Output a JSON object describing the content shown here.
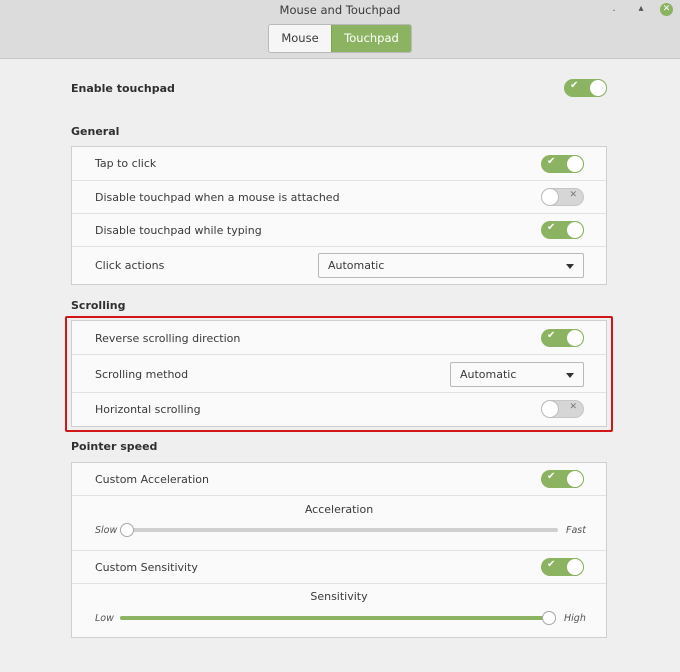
{
  "window": {
    "title": "Mouse and Touchpad"
  },
  "tabs": [
    {
      "label": "Mouse",
      "active": false
    },
    {
      "label": "Touchpad",
      "active": true
    }
  ],
  "enable_touchpad": {
    "label": "Enable touchpad",
    "on": true
  },
  "general": {
    "title": "General",
    "tap_to_click": {
      "label": "Tap to click",
      "on": true
    },
    "disable_when_mouse": {
      "label": "Disable touchpad when a mouse is attached",
      "on": false
    },
    "disable_while_typing": {
      "label": "Disable touchpad while typing",
      "on": true
    },
    "click_actions": {
      "label": "Click actions",
      "value": "Automatic"
    }
  },
  "scrolling": {
    "title": "Scrolling",
    "reverse": {
      "label": "Reverse scrolling direction",
      "on": true
    },
    "method": {
      "label": "Scrolling method",
      "value": "Automatic"
    },
    "horizontal": {
      "label": "Horizontal scrolling",
      "on": false
    }
  },
  "pointer_speed": {
    "title": "Pointer speed",
    "custom_acceleration": {
      "label": "Custom Acceleration",
      "on": true
    },
    "acceleration": {
      "title": "Acceleration",
      "min_label": "Slow",
      "max_label": "Fast",
      "value": 0.0
    },
    "custom_sensitivity": {
      "label": "Custom Sensitivity",
      "on": true
    },
    "sensitivity": {
      "title": "Sensitivity",
      "min_label": "Low",
      "max_label": "High",
      "value": 1.0
    }
  },
  "colors": {
    "accent": "#8cb361",
    "highlight": "#d01616"
  }
}
